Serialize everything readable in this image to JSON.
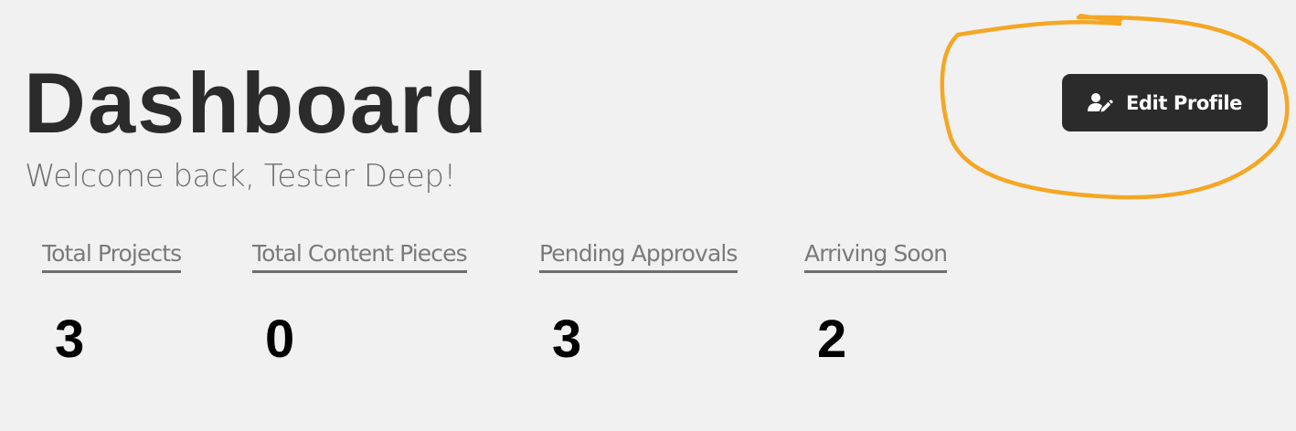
{
  "header": {
    "title": "Dashboard",
    "welcome": "Welcome back, Tester Deep!",
    "edit_profile_label": "Edit Profile",
    "edit_profile_icon": "user-edit-icon"
  },
  "stats": [
    {
      "label": "Total Projects",
      "value": "3"
    },
    {
      "label": "Total Content Pieces",
      "value": "0"
    },
    {
      "label": "Pending Approvals",
      "value": "3"
    },
    {
      "label": "Arriving Soon",
      "value": "2"
    }
  ],
  "colors": {
    "background": "#f1f1f1",
    "button": "#2b2b2b",
    "annotation": "#f5a623"
  }
}
